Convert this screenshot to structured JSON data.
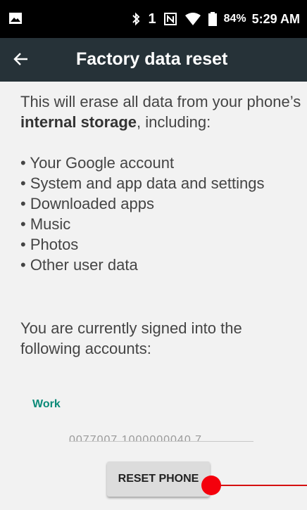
{
  "status_bar": {
    "battery_percent": "84%",
    "time": "5:29 AM",
    "icons": [
      "image-icon",
      "bluetooth-icon",
      "sim-1-icon",
      "nfc-icon",
      "wifi-icon",
      "battery-icon"
    ],
    "sim_label": "1"
  },
  "app_bar": {
    "title": "Factory data reset",
    "back_icon": "back-arrow-icon",
    "background": "#263238"
  },
  "content": {
    "intro_prefix": "This will erase all data from your phone’s ",
    "intro_bold": "internal storage",
    "intro_suffix": ", including:",
    "items": [
      "• Your Google account",
      "• System and app data and settings",
      "• Downloaded apps",
      "• Music",
      "• Photos",
      "• Other user data"
    ],
    "signed_in_text": "You are currently signed into the following accounts:"
  },
  "account": {
    "label": "Work",
    "label_color": "#0b8a78",
    "email_partial": "0077007 1000000040 7"
  },
  "actions": {
    "reset_label": "RESET PHONE"
  },
  "overlay": {
    "marker_color": "#f4000c"
  }
}
